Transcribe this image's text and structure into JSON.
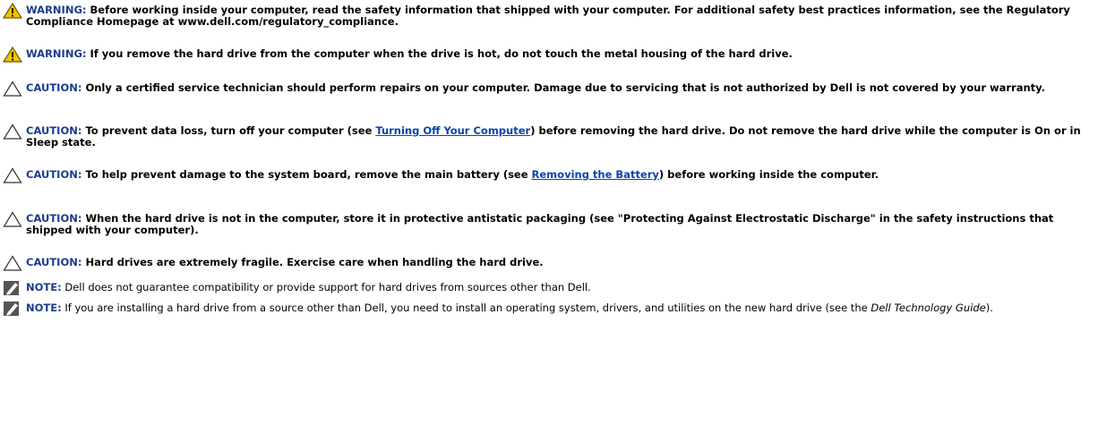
{
  "colors": {
    "label": "#1a3d8c",
    "link": "#0645ad",
    "warning_fill": "#f2c200",
    "warning_stroke": "#6b5a00"
  },
  "notices": [
    {
      "type": "warning",
      "icon": "warning-triangle-icon",
      "label": "WARNING:",
      "text": "Before working inside your computer, read the safety information that shipped with your computer. For additional safety best practices information, see the Regulatory Compliance Homepage at www.dell.com/regulatory_compliance."
    },
    {
      "type": "warning",
      "icon": "warning-triangle-icon",
      "label": "WARNING:",
      "text": "If you remove the hard drive from the computer when the drive is hot, do not touch the metal housing of the hard drive."
    },
    {
      "type": "caution",
      "icon": "caution-triangle-icon",
      "label": "CAUTION:",
      "text": "Only a certified service technician should perform repairs on your computer. Damage due to servicing that is not authorized by Dell is not covered by your warranty."
    },
    {
      "type": "caution",
      "icon": "caution-triangle-icon",
      "label": "CAUTION:",
      "text_before": "To prevent data loss, turn off your computer (see ",
      "link": "Turning Off Your Computer",
      "text_after": ") before removing the hard drive. Do not remove the hard drive while the computer is On or in Sleep state."
    },
    {
      "type": "caution",
      "icon": "caution-triangle-icon",
      "label": "CAUTION:",
      "text_before": "To help prevent damage to the system board, remove the main battery (see ",
      "link": "Removing the Battery",
      "text_after": ") before working inside the computer."
    },
    {
      "type": "caution",
      "icon": "caution-triangle-icon",
      "label": "CAUTION:",
      "text": "When the hard drive is not in the computer, store it in protective antistatic packaging (see \"Protecting Against Electrostatic Discharge\" in the safety instructions that shipped with your computer)."
    },
    {
      "type": "caution",
      "icon": "caution-triangle-icon",
      "label": "CAUTION:",
      "text": "Hard drives are extremely fragile. Exercise care when handling the hard drive."
    },
    {
      "type": "note",
      "icon": "pencil-note-icon",
      "label": "NOTE:",
      "text": "Dell does not guarantee compatibility or provide support for hard drives from sources other than Dell."
    },
    {
      "type": "note",
      "icon": "pencil-note-icon",
      "label": "NOTE:",
      "text_before": "If you are installing a hard drive from a source other than Dell, you need to install an operating system, drivers, and utilities on the new hard drive (see the ",
      "italic": "Dell Technology Guide",
      "text_after": ")."
    }
  ]
}
